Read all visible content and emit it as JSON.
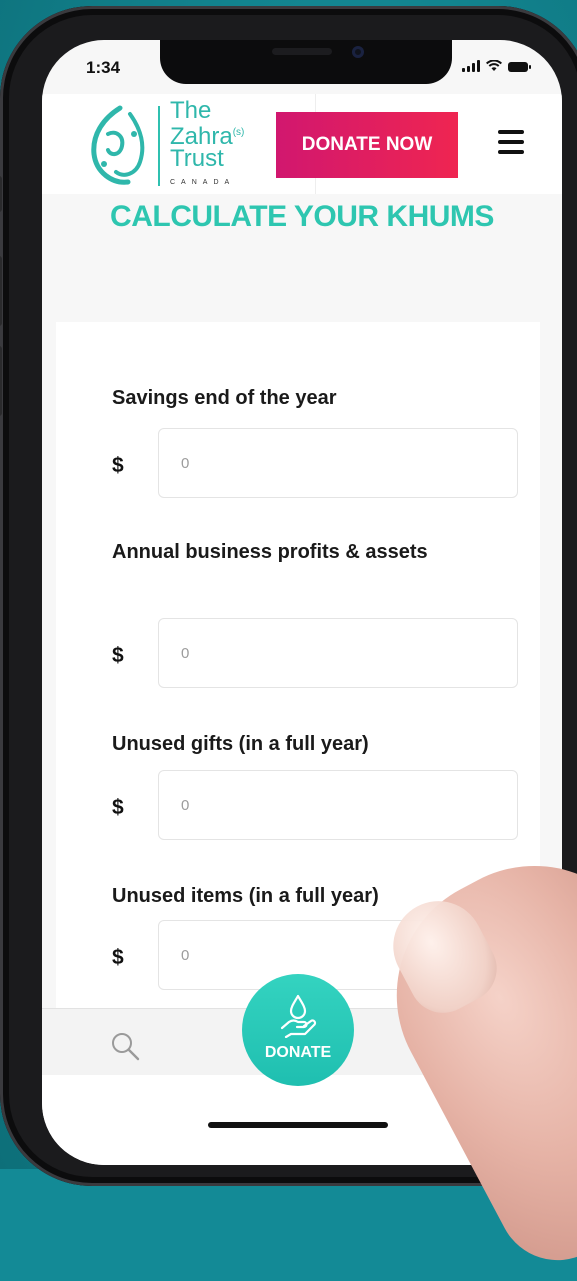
{
  "status_bar": {
    "time": "1:34"
  },
  "header": {
    "logo": {
      "line1": "The",
      "line2": "Zahra",
      "superscript": "(s)",
      "line3": "Trust",
      "line4": "CANADA"
    },
    "donate_now_label": "DONATE NOW"
  },
  "page_title": "CALCULATE YOUR KHUMS",
  "form": {
    "currency_symbol": "$",
    "fields": [
      {
        "label": "Savings end of the year",
        "placeholder": "0"
      },
      {
        "label": "Annual business profits & assets",
        "placeholder": "0"
      },
      {
        "label": "Unused gifts (in a full year)",
        "placeholder": "0"
      },
      {
        "label": "Unused items (in a full year)",
        "placeholder": "0"
      }
    ]
  },
  "bottom_nav": {
    "donate_label": "DONATE"
  },
  "colors": {
    "brand_teal": "#2ec6b0",
    "donate_gradient_start": "#d1176f",
    "donate_gradient_end": "#ef2551",
    "background": "#138a96"
  },
  "icons": [
    "search-icon",
    "hamburger-menu-icon",
    "donate-hand-icon",
    "signal-icon",
    "wifi-icon",
    "battery-icon"
  ]
}
